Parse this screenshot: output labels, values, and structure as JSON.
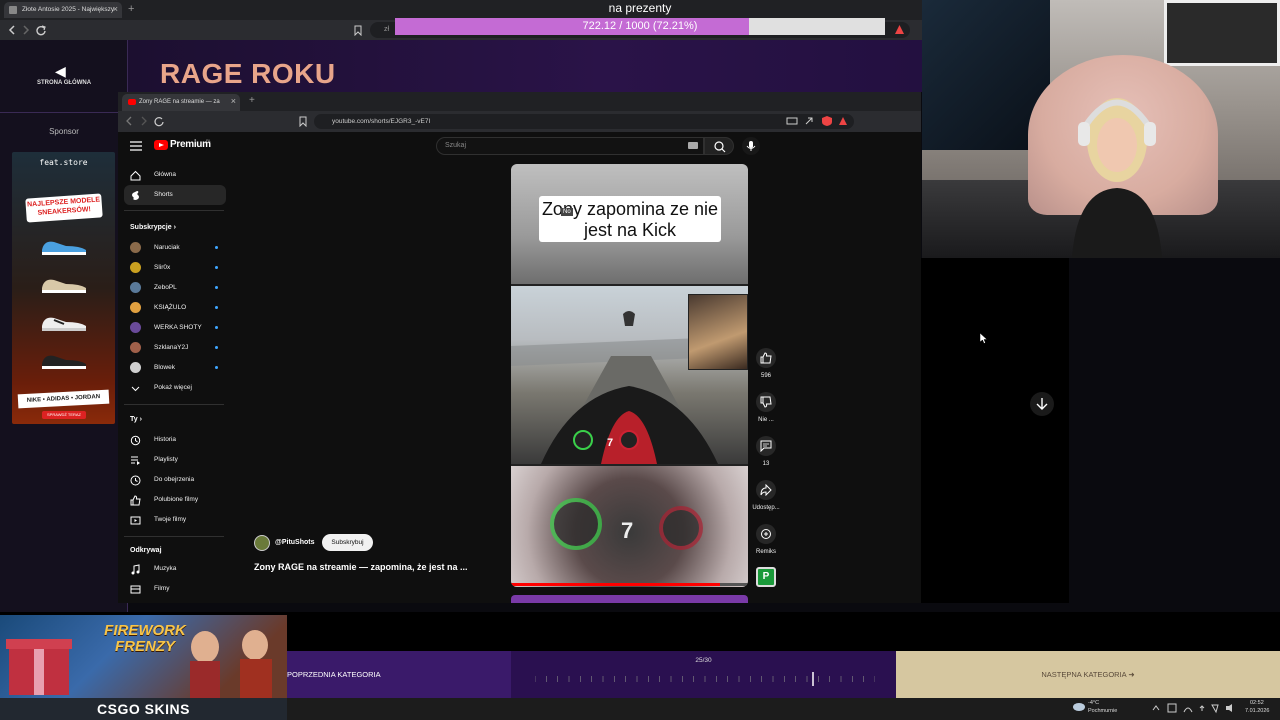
{
  "outer_browser": {
    "tab_title": "Złote Antosie 2025 - Największy",
    "url_partial": "zł"
  },
  "donation_goal": {
    "label": "na prezenty",
    "progress_text": "722.12 / 1000 (72.21%)",
    "progress": 0.7221,
    "fill_color": "#c46bd4"
  },
  "page": {
    "title": "RAGE ROKU",
    "home_label": "STRONA GŁÓWNA",
    "sponsor_label": "Sponsor"
  },
  "sponsor_ad": {
    "brand": "feat.store",
    "banner": "NAJLEPSZE MODELE SNEAKERSÓW!",
    "brands_strip": "NIKE • ADIDAS • JORDAN",
    "cta": "SPRAWDŹ TERAZ"
  },
  "inner_browser": {
    "tab_title": "Zony RAGE na streamie — za",
    "url": "youtube.com/shorts/EJGR3_-vE7I"
  },
  "youtube": {
    "brand": "Premium",
    "region": "PL",
    "search_placeholder": "Szukaj",
    "sidebar": {
      "main": [
        {
          "label": "Główna",
          "icon": "home-icon"
        },
        {
          "label": "Shorts",
          "icon": "shorts-icon"
        }
      ],
      "subscriptions_heading": "Subskrypcje",
      "subscriptions": [
        {
          "label": "Naruciak",
          "color": "#8a6a4a"
        },
        {
          "label": "Slir0x",
          "color": "#c9a020"
        },
        {
          "label": "ZeboPL",
          "color": "#5a7a9a"
        },
        {
          "label": "KSIĄŻULO",
          "color": "#e0a040"
        },
        {
          "label": "WERKA SHOTY",
          "color": "#6a4a9a"
        },
        {
          "label": "SzklanaY2J",
          "color": "#a0604a"
        },
        {
          "label": "Blowek",
          "color": "#d0d0d0"
        }
      ],
      "show_more": "Pokaż więcej",
      "you_heading": "Ty",
      "you_items": [
        {
          "label": "Historia",
          "icon": "history-icon"
        },
        {
          "label": "Playlisty",
          "icon": "playlist-icon"
        },
        {
          "label": "Do obejrzenia",
          "icon": "clock-icon"
        },
        {
          "label": "Polubione filmy",
          "icon": "thumbs-up-icon"
        },
        {
          "label": "Twoje filmy",
          "icon": "video-icon"
        }
      ],
      "explore_heading": "Odkrywaj",
      "explore_items": [
        {
          "label": "Muzyka",
          "icon": "music-icon"
        },
        {
          "label": "Filmy",
          "icon": "film-icon"
        }
      ]
    },
    "short": {
      "caption": "Zony zapomina ze nie jest na Kick",
      "overlay_tag": "No",
      "channel": "@PituShots",
      "subscribe_label": "Subskrybuj",
      "title": "Zony RAGE na streamie — zapomina, że jest na ...",
      "progress": 0.88,
      "actions": {
        "likes": "596",
        "dislike_label": "Nie ...",
        "comments": "13",
        "share_label": "Udostęp...",
        "remix_label": "Remiks"
      }
    }
  },
  "bottom": {
    "game_ad_title": "FIREWORK FRENZY",
    "csgo_label": "CSGO SKINS",
    "prev_category": "POPRZEDNIA KATEGORIA",
    "next_category": "NASTĘPNA KATEGORIA",
    "category_count": "25/30"
  },
  "taskbar": {
    "temp": "-4°C",
    "weather": "Pochmurnie",
    "time": "02:52",
    "date": "7.01.2026"
  }
}
